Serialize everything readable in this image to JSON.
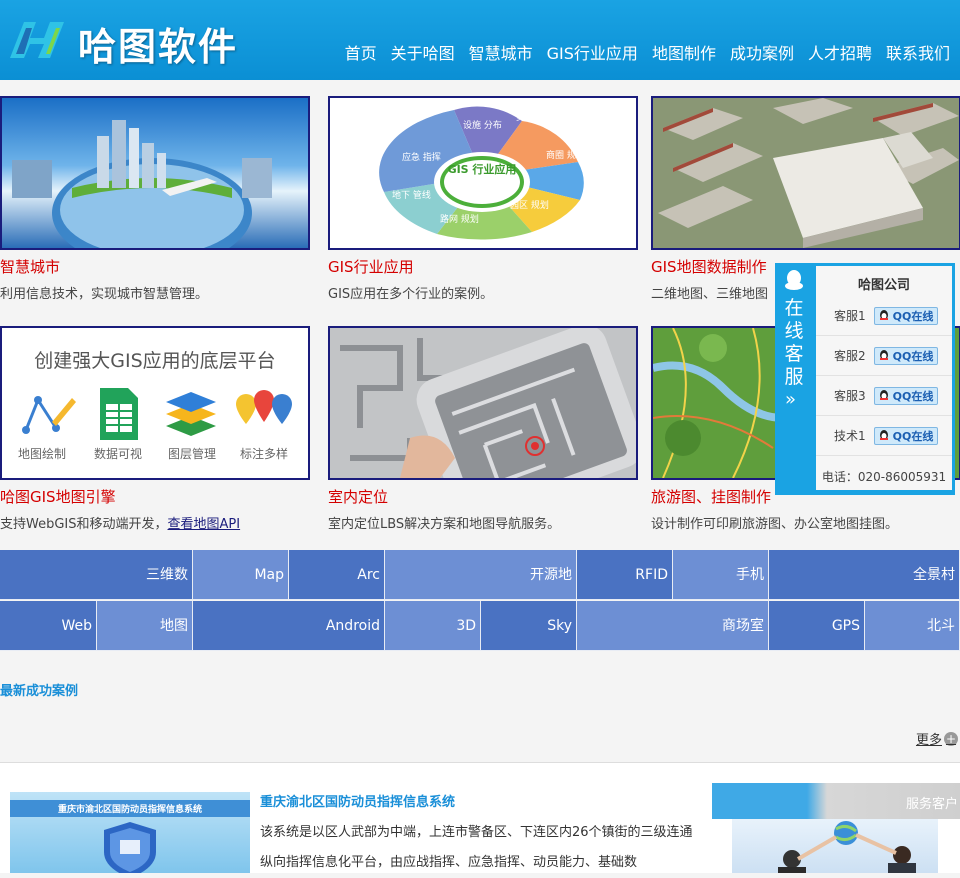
{
  "brand": {
    "name": "哈图软件"
  },
  "nav": [
    "首页",
    "关于哈图",
    "智慧城市",
    "GIS行业应用",
    "地图制作",
    "成功案例",
    "人才招聘",
    "联系我们"
  ],
  "cards": [
    {
      "title": "智慧城市",
      "desc": "利用信息技术，实现城市智慧管理。"
    },
    {
      "title": "GIS行业应用",
      "desc": "GIS应用在多个行业的案例。",
      "wheel": {
        "center": "GIS 行业应用",
        "segments": [
          "设施 分布",
          "资源 规划",
          "商圈 规划",
          "园区 规划",
          "路网 规划",
          "地下 管线",
          "应急 指挥"
        ]
      }
    },
    {
      "title": "GIS地图数据制作",
      "desc": "二维地图、三维地图"
    },
    {
      "title": "哈图GIS地图引擎",
      "desc": "支持WebGIS和移动端开发，",
      "link": "查看地图API",
      "banner": {
        "heading": "创建强大GIS应用的底层平台",
        "items": [
          "地图绘制",
          "数据可视",
          "图层管理",
          "标注多样"
        ]
      }
    },
    {
      "title": "室内定位",
      "desc": "室内定位LBS解决方案和地图导航服务。"
    },
    {
      "title": "旅游图、挂图制作",
      "desc": "设计制作可印刷旅游图、办公室地图挂图。"
    }
  ],
  "tags_row1": [
    "三维数",
    "Map",
    "Arc",
    "开源地",
    "RFID",
    "手机",
    "全景村"
  ],
  "tags_row2": [
    "Web",
    "地图",
    "Android",
    "3D",
    "Sky",
    "商场室",
    "GPS",
    "北斗"
  ],
  "section": {
    "title": "最新成功案例",
    "more": "更多"
  },
  "case": {
    "title": "重庆渝北区国防动员指挥信息系统",
    "banner_text": "重庆市渝北区国防动员指挥信息系统",
    "text": "该系统是以区人武部为中端，上连市警备区、下连区内26个镇街的三级连通纵向指挥信息化平台，由应战指挥、应急指挥、动员能力、基础数"
  },
  "service_box": {
    "title": "服务客户"
  },
  "kefu": {
    "tab_text": [
      "在",
      "线",
      "客",
      "服"
    ],
    "arrow": "»",
    "company": "哈图公司",
    "qq_label": "QQ在线",
    "staff": [
      "客服1",
      "客服2",
      "客服3",
      "技术1"
    ],
    "phone": "电话：020-86005931"
  },
  "colors": {
    "header": "#0b8fd4",
    "accent_red": "#d40000",
    "link_blue": "#1a8fd8",
    "tag_dark": "#4a72c2",
    "tag_light": "#6d8fd4"
  }
}
